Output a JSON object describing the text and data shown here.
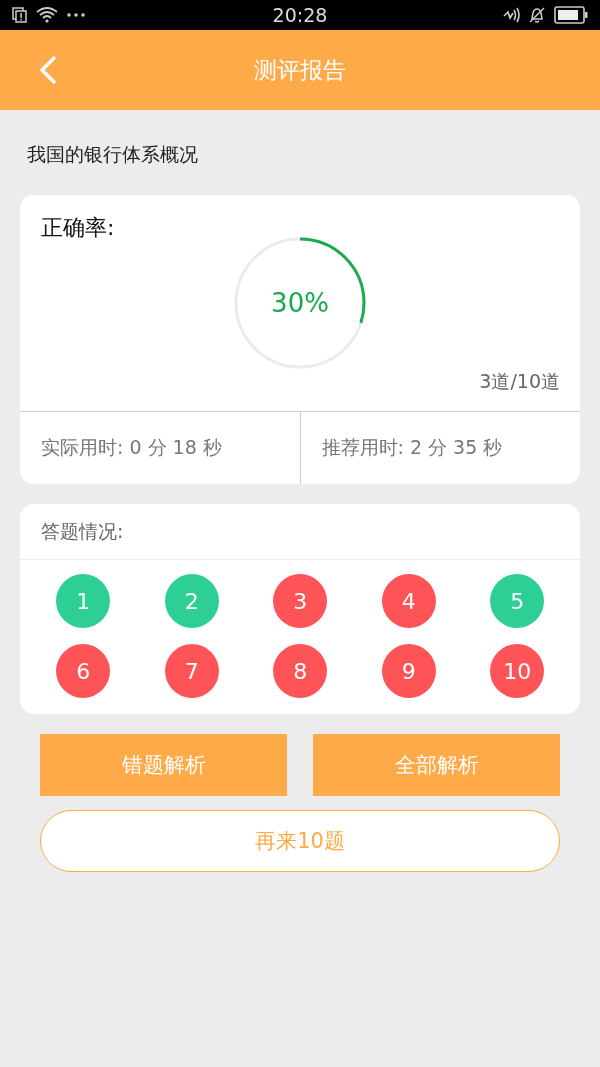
{
  "status_bar": {
    "time": "20:28"
  },
  "header": {
    "title": "测评报告"
  },
  "quiz_title": "我国的银行体系概况",
  "result": {
    "label": "正确率:",
    "percent": "30%",
    "count": "3道/10道",
    "actual_time": "实际用时: 0 分 18 秒",
    "recommended_time": "推荐用时: 2 分 35 秒"
  },
  "answers": {
    "label": "答题情况:",
    "items": [
      {
        "number": "1",
        "correct": true
      },
      {
        "number": "2",
        "correct": true
      },
      {
        "number": "3",
        "correct": false
      },
      {
        "number": "4",
        "correct": false
      },
      {
        "number": "5",
        "correct": true
      },
      {
        "number": "6",
        "correct": false
      },
      {
        "number": "7",
        "correct": false
      },
      {
        "number": "8",
        "correct": false
      },
      {
        "number": "9",
        "correct": false
      },
      {
        "number": "10",
        "correct": false
      }
    ]
  },
  "buttons": [
    "错题解析",
    "全部解析"
  ],
  "retry_button": "再来10题"
}
